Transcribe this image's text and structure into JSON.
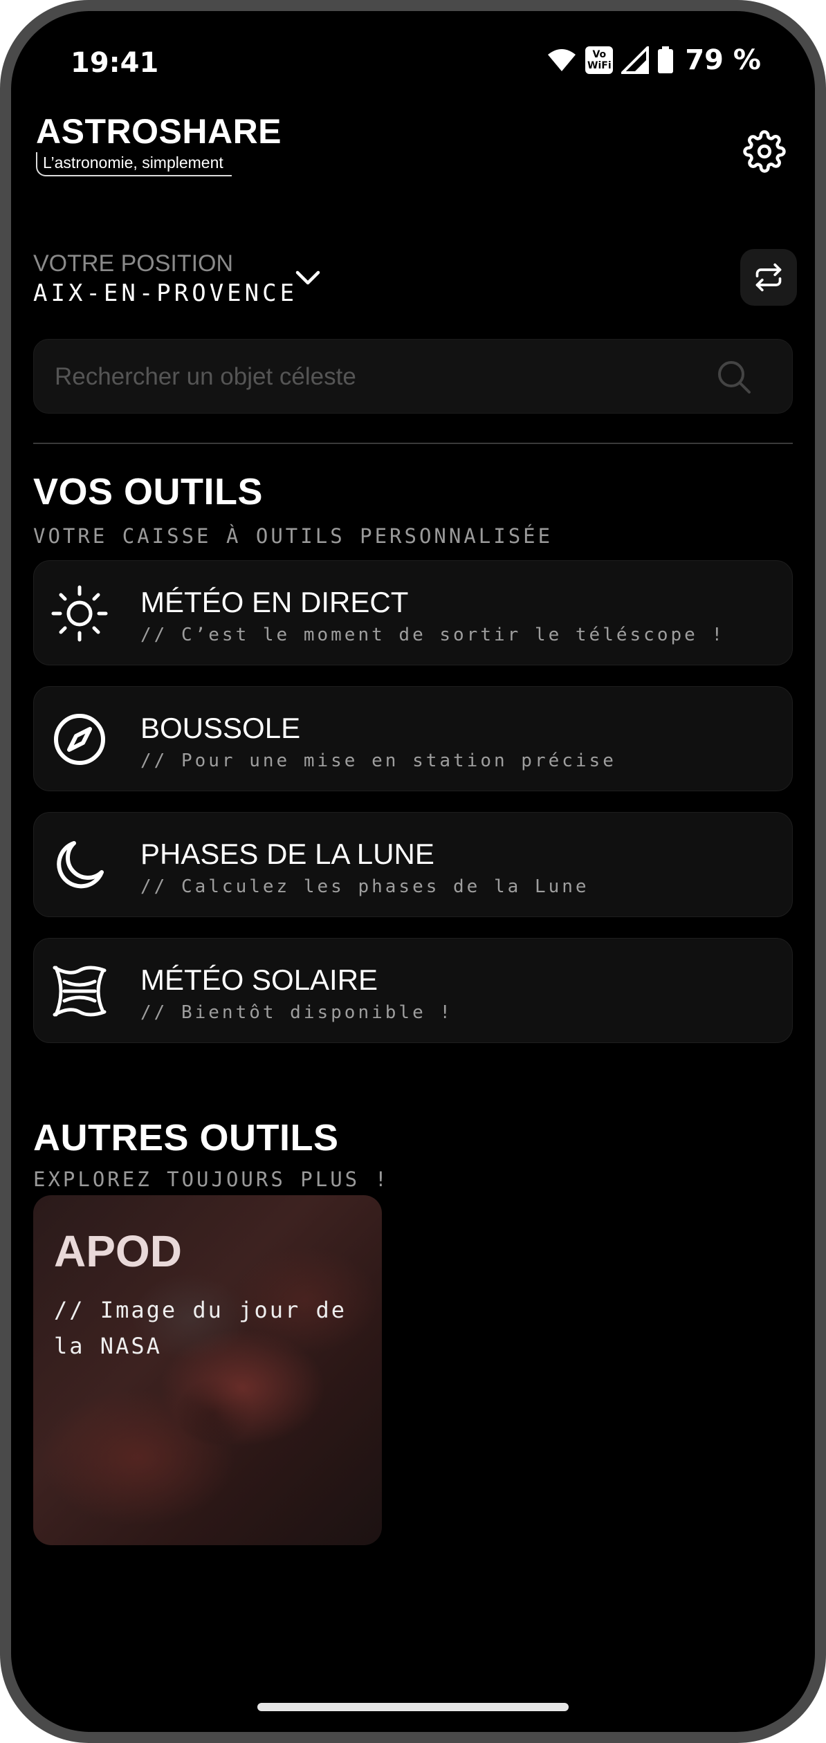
{
  "status_bar": {
    "time": "19:41",
    "vowifi_label": "Vo WiFi",
    "battery": "79 %"
  },
  "header": {
    "title": "ASTROSHARE",
    "subtitle": "L’astronomie, simplement"
  },
  "position": {
    "label": "VOTRE POSITION",
    "value": "AIX-EN-PROVENCE"
  },
  "search": {
    "placeholder": "Rechercher un objet céleste",
    "value": ""
  },
  "tools_section": {
    "title": "VOS OUTILS",
    "subtitle": "VOTRE CAISSE À OUTILS PERSONNALISÉE",
    "items": [
      {
        "title": "MÉTÉO EN DIRECT",
        "desc": "// C’est le moment de sortir le téléscope !",
        "icon": "sun-icon"
      },
      {
        "title": "BOUSSOLE",
        "desc": "// Pour une mise en station précise",
        "icon": "compass-icon"
      },
      {
        "title": "PHASES DE LA LUNE",
        "desc": "// Calculez les phases de la Lune",
        "icon": "moon-icon"
      },
      {
        "title": "MÉTÉO SOLAIRE",
        "desc": "// Bientôt disponible !",
        "icon": "solar-storm-icon"
      }
    ]
  },
  "other_section": {
    "title": "AUTRES OUTILS",
    "subtitle": "EXPLOREZ TOUJOURS PLUS !",
    "apod": {
      "title": "APOD",
      "desc": "// Image du jour de la NASA"
    }
  },
  "colors": {
    "background": "#000000",
    "card": "#101010",
    "muted_text": "#9e9e9e"
  }
}
